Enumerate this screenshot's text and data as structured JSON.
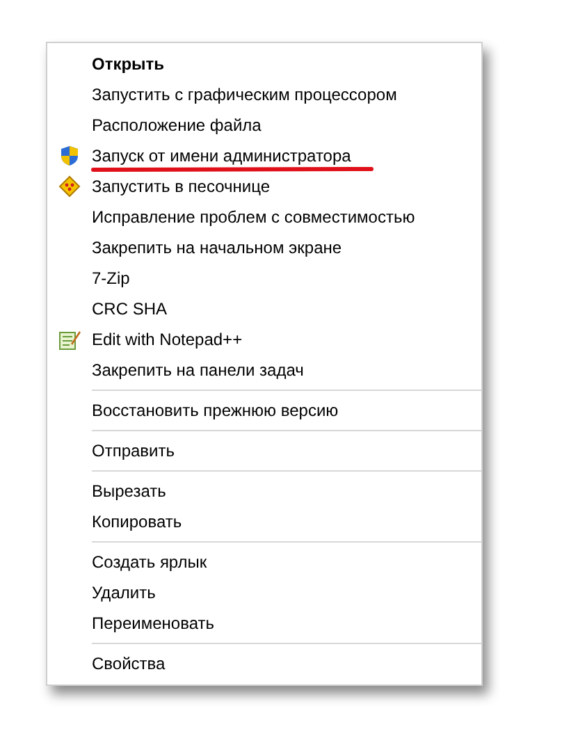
{
  "menu": {
    "groups": [
      {
        "items": [
          {
            "label": "Открыть",
            "bold": true,
            "underlined": false,
            "kind": "plain"
          },
          {
            "label": "Запустить с графическим процессором",
            "bold": false,
            "underlined": false,
            "kind": "plain"
          },
          {
            "label": "Расположение файла",
            "bold": false,
            "underlined": false,
            "kind": "plain"
          },
          {
            "label": "Запуск от имени администратора",
            "bold": false,
            "underlined": true,
            "kind": "shield"
          },
          {
            "label": "Запустить в песочнице",
            "bold": false,
            "underlined": false,
            "kind": "sandbox"
          },
          {
            "label": "Исправление проблем с совместимостью",
            "bold": false,
            "underlined": false,
            "kind": "plain"
          },
          {
            "label": "Закрепить на начальном экране",
            "bold": false,
            "underlined": false,
            "kind": "plain"
          },
          {
            "label": "7-Zip",
            "bold": false,
            "underlined": false,
            "kind": "plain"
          },
          {
            "label": "CRC SHA",
            "bold": false,
            "underlined": false,
            "kind": "plain"
          },
          {
            "label": "Edit with Notepad++",
            "bold": false,
            "underlined": false,
            "kind": "notepad"
          },
          {
            "label": "Закрепить на панели задач",
            "bold": false,
            "underlined": false,
            "kind": "plain"
          }
        ]
      },
      {
        "items": [
          {
            "label": "Восстановить прежнюю версию",
            "bold": false,
            "underlined": false,
            "kind": "plain"
          }
        ]
      },
      {
        "items": [
          {
            "label": "Отправить",
            "bold": false,
            "underlined": false,
            "kind": "plain"
          }
        ]
      },
      {
        "items": [
          {
            "label": "Вырезать",
            "bold": false,
            "underlined": false,
            "kind": "plain"
          },
          {
            "label": "Копировать",
            "bold": false,
            "underlined": false,
            "kind": "plain"
          }
        ]
      },
      {
        "items": [
          {
            "label": "Создать ярлык",
            "bold": false,
            "underlined": false,
            "kind": "plain"
          },
          {
            "label": "Удалить",
            "bold": false,
            "underlined": false,
            "kind": "plain"
          },
          {
            "label": "Переименовать",
            "bold": false,
            "underlined": false,
            "kind": "plain"
          }
        ]
      },
      {
        "items": [
          {
            "label": "Свойства",
            "bold": false,
            "underlined": false,
            "kind": "plain"
          }
        ]
      }
    ]
  }
}
